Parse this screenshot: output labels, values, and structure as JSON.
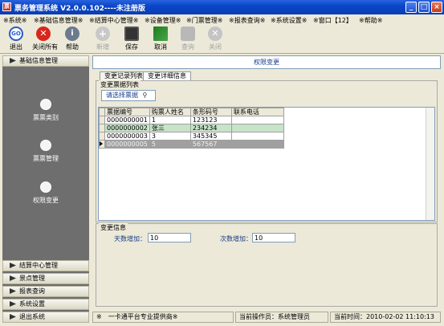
{
  "window": {
    "title": "票务管理系统 V2.0.0.102----未注册版",
    "buttons": {
      "minimize": "_",
      "maximize": "□",
      "close": "×"
    }
  },
  "menu": [
    "※系统※",
    "※基础信息管理※",
    "※结算中心管理※",
    "※设备管理※",
    "※门票管理※",
    "※报表查询※",
    "※系统设置※",
    "※窗口【12】",
    "※帮助※"
  ],
  "toolbar": {
    "exit": "退出",
    "close_all": "关闭所有",
    "help": "帮助",
    "add": "新增",
    "save": "保存",
    "cancel": "取消",
    "query": "查询",
    "close": "关闭",
    "go_text": "GO"
  },
  "sidebar": {
    "header": "基础信息管理",
    "items": [
      "票票类别",
      "票票管理",
      "权限变更"
    ],
    "sections": [
      "结算中心管理",
      "景点管理",
      "报表查询",
      "系统设置",
      "退出系统"
    ]
  },
  "main": {
    "header": "权限变更",
    "tabs": [
      "变更记录列表",
      "变更详细信息"
    ],
    "list_group": "变更票据列表",
    "select_button": "请选择票据",
    "columns": [
      "票据编号",
      "购票人姓名",
      "条形码号",
      "联系电话"
    ],
    "rows": [
      {
        "id": "0000000001",
        "name": "1",
        "barcode": "123123",
        "phone": ""
      },
      {
        "id": "0000000002",
        "name": "张三",
        "barcode": "234234",
        "phone": ""
      },
      {
        "id": "0000000003",
        "name": "3",
        "barcode": "345345",
        "phone": ""
      },
      {
        "id": "0000000005",
        "name": "5",
        "barcode": "567567",
        "phone": ""
      }
    ],
    "info_group": "变更信息",
    "days_label": "天数增加：",
    "days_value": "10",
    "times_label": "次数增加：",
    "times_value": "10"
  },
  "status": {
    "provider": "※　一卡通平台专业提供商※",
    "operator": "当前操作员：系统管理员",
    "time": "当前时间：2010-02-02  11:10:13"
  }
}
